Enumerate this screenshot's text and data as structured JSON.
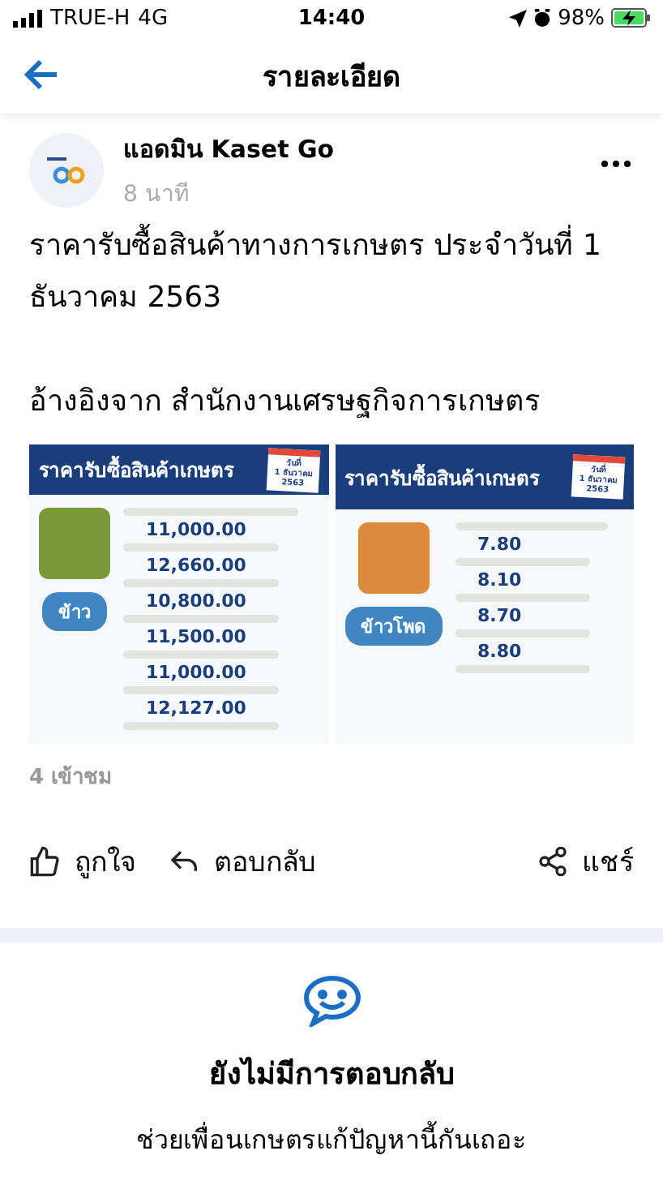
{
  "status_bar": {
    "carrier": "TRUE-H",
    "network": "4G",
    "time": "14:40",
    "battery": "98%"
  },
  "header": {
    "title": "รายละเอียด"
  },
  "post": {
    "author": "แอดมิน Kaset Go",
    "time": "8 นาที",
    "text": "ราคารับซื้อสินค้าทางการเกษตร ประจำวันที่ 1 ธันวาคม 2563",
    "reference": "อ้างอิงจาก สำนักงานเศรษฐกิจการเกษตร",
    "images": [
      {
        "title": "ราคารับซื้อสินค้าเกษตร",
        "date": [
          "วันที่",
          "1 ธันวาคม",
          "2563"
        ],
        "crop": "ข้าว",
        "kind": "rice",
        "prices": [
          "11,000.00",
          "12,660.00",
          "10,800.00",
          "11,500.00",
          "11,000.00",
          "12,127.00"
        ]
      },
      {
        "title": "ราคารับซื้อสินค้าเกษตร",
        "date": [
          "วันที่",
          "1 ธันวาคม",
          "2563"
        ],
        "crop": "ข้าวโพด",
        "kind": "corn",
        "prices": [
          "7.80",
          "8.10",
          "8.70",
          "8.80"
        ]
      }
    ],
    "views": "4 เข้าชม",
    "actions": [
      {
        "kind": "like",
        "label": "ถูกใจ"
      },
      {
        "kind": "reply",
        "label": "ตอบกลับ"
      },
      {
        "kind": "share",
        "label": "แชร์"
      }
    ]
  },
  "empty_state": {
    "title": "ยังไม่มีการตอบกลับ",
    "subtitle": "ช่วยเพื่อนเกษตรแก้ปัญหานี้กันเถอะ"
  }
}
